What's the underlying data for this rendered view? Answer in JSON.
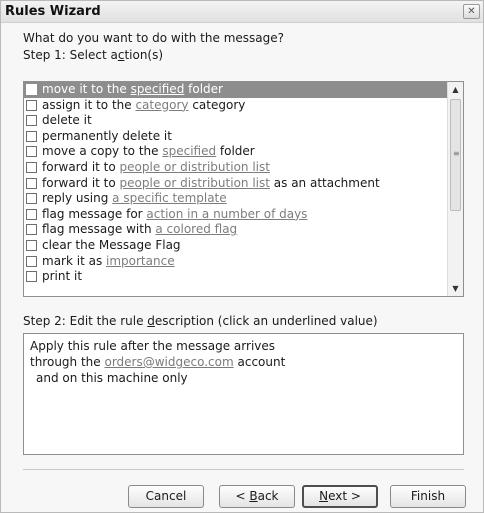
{
  "window": {
    "title": "Rules Wizard"
  },
  "prompt": "What do you want to do with the message?",
  "step1": {
    "pre": "Step 1: Select a",
    "accel": "c",
    "post": "tion(s)"
  },
  "actions": [
    {
      "before": "move it to the ",
      "link": "specified",
      "after": " folder",
      "selected": true
    },
    {
      "before": "assign it to the ",
      "link": "category",
      "after": " category"
    },
    {
      "before": "delete it",
      "link": "",
      "after": ""
    },
    {
      "before": "permanently delete it",
      "link": "",
      "after": ""
    },
    {
      "before": "move a copy to the ",
      "link": "specified",
      "after": " folder"
    },
    {
      "before": "forward it to ",
      "link": "people or distribution list",
      "after": ""
    },
    {
      "before": "forward it to ",
      "link": "people or distribution list",
      "after": " as an attachment"
    },
    {
      "before": "reply using ",
      "link": "a specific template",
      "after": ""
    },
    {
      "before": "flag message for ",
      "link": "action in a number of days",
      "after": ""
    },
    {
      "before": "flag message with ",
      "link": "a colored flag",
      "after": ""
    },
    {
      "before": "clear the Message Flag",
      "link": "",
      "after": ""
    },
    {
      "before": "mark it as ",
      "link": "importance",
      "after": ""
    },
    {
      "before": "print it",
      "link": "",
      "after": ""
    }
  ],
  "step2": {
    "pre": "Step 2: Edit the rule ",
    "accel": "d",
    "post": "escription (click an underlined value)"
  },
  "description": {
    "line1": "Apply this rule after the message arrives",
    "line2_before": "through the ",
    "line2_link": "orders@widgeco.com",
    "line2_after": " account",
    "line3": "and on this machine only"
  },
  "buttons": {
    "cancel": "Cancel",
    "back_pre": "< ",
    "back_accel": "B",
    "back_post": "ack",
    "next_accel": "N",
    "next_post": "ext >",
    "finish": "Finish"
  },
  "icons": {
    "close": "close-icon",
    "scroll_up": "arrow-up-icon",
    "scroll_down": "arrow-down-icon"
  }
}
